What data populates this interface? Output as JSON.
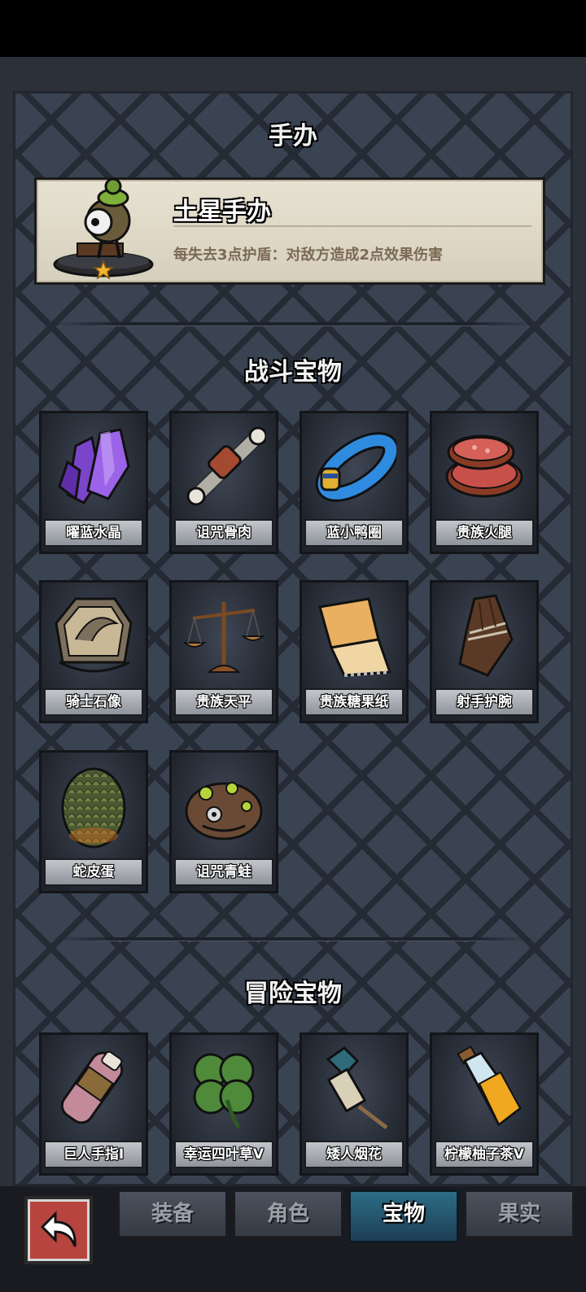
{
  "figure_section": {
    "title": "手办",
    "name": "土星手办",
    "description": "每失去3点护盾：对敌方造成2点效果伤害"
  },
  "battle_section": {
    "title": "战斗宝物",
    "items": [
      {
        "label": "曜蓝水晶",
        "icon": "purple-crystal-icon"
      },
      {
        "label": "诅咒骨肉",
        "icon": "meat-bone-icon"
      },
      {
        "label": "蓝小鸭圈",
        "icon": "duck-ring-icon"
      },
      {
        "label": "贵族火腿",
        "icon": "ham-icon"
      },
      {
        "label": "骑士石像",
        "icon": "stone-emblem-icon"
      },
      {
        "label": "贵族天平",
        "icon": "scale-icon"
      },
      {
        "label": "贵族糖果纸",
        "icon": "candy-paper-icon"
      },
      {
        "label": "射手护腕",
        "icon": "bracer-icon"
      },
      {
        "label": "蛇皮蛋",
        "icon": "snake-egg-icon"
      },
      {
        "label": "诅咒青蛙",
        "icon": "cursed-frog-icon"
      }
    ]
  },
  "adventure_section": {
    "title": "冒险宝物",
    "items": [
      {
        "label": "巨人手指I",
        "icon": "giant-finger-icon"
      },
      {
        "label": "幸运四叶草V",
        "icon": "four-leaf-clover-icon"
      },
      {
        "label": "矮人烟花",
        "icon": "firework-icon"
      },
      {
        "label": "柠檬柚子茶V",
        "icon": "tea-bottle-icon"
      }
    ]
  },
  "nav": {
    "tabs": [
      "装备",
      "角色",
      "宝物",
      "果实"
    ],
    "active": "宝物"
  }
}
